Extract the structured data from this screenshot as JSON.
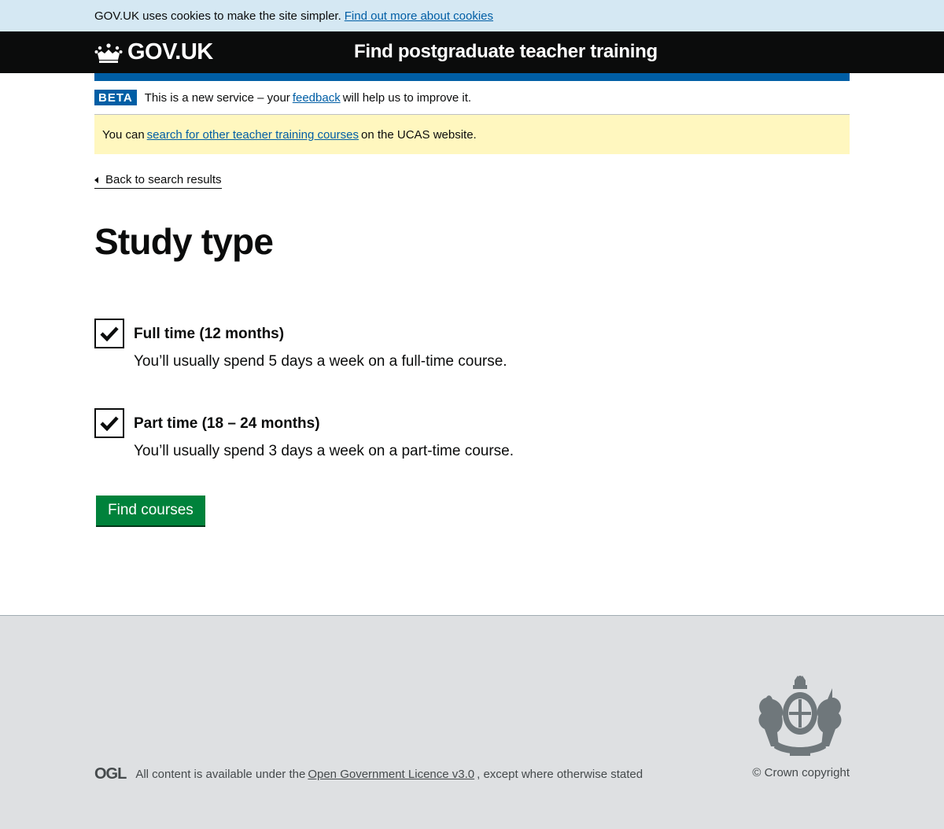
{
  "cookie_banner": {
    "text": "GOV.UK uses cookies to make the site simpler.",
    "link": "Find out more about cookies"
  },
  "header": {
    "logo_text": "GOV.UK",
    "service_name": "Find postgraduate teacher training"
  },
  "phase_banner": {
    "tag": "BETA",
    "text_before": "This is a new service – your",
    "link": "feedback",
    "text_after": "will help us to improve it."
  },
  "notice": {
    "text_before": "You can",
    "link": "search for other teacher training courses",
    "text_after": "on the UCAS website."
  },
  "back_link": "Back to search results",
  "page_title": "Study type",
  "options": [
    {
      "label": "Full time (12 months)",
      "hint": "You’ll usually spend 5 days a week on a full-time course.",
      "checked": true
    },
    {
      "label": "Part time (18 – 24 months)",
      "hint": "You’ll usually spend 3 days a week on a part-time course.",
      "checked": true
    }
  ],
  "submit_label": "Find courses",
  "footer": {
    "ogl_logo": "OGL",
    "licence_before": "All content is available under the",
    "licence_link": "Open Government Licence v3.0",
    "licence_after": ", except where otherwise stated",
    "copyright": "© Crown copyright"
  },
  "colors": {
    "link": "#005ea5",
    "header_bg": "#0b0c0c",
    "button_green": "#00823b",
    "notice_bg": "#fff7bf",
    "footer_bg": "#dee0e2"
  },
  "icons": [
    "crown-icon",
    "back-arrow-icon",
    "checkmark-icon",
    "royal-crest-icon"
  ]
}
